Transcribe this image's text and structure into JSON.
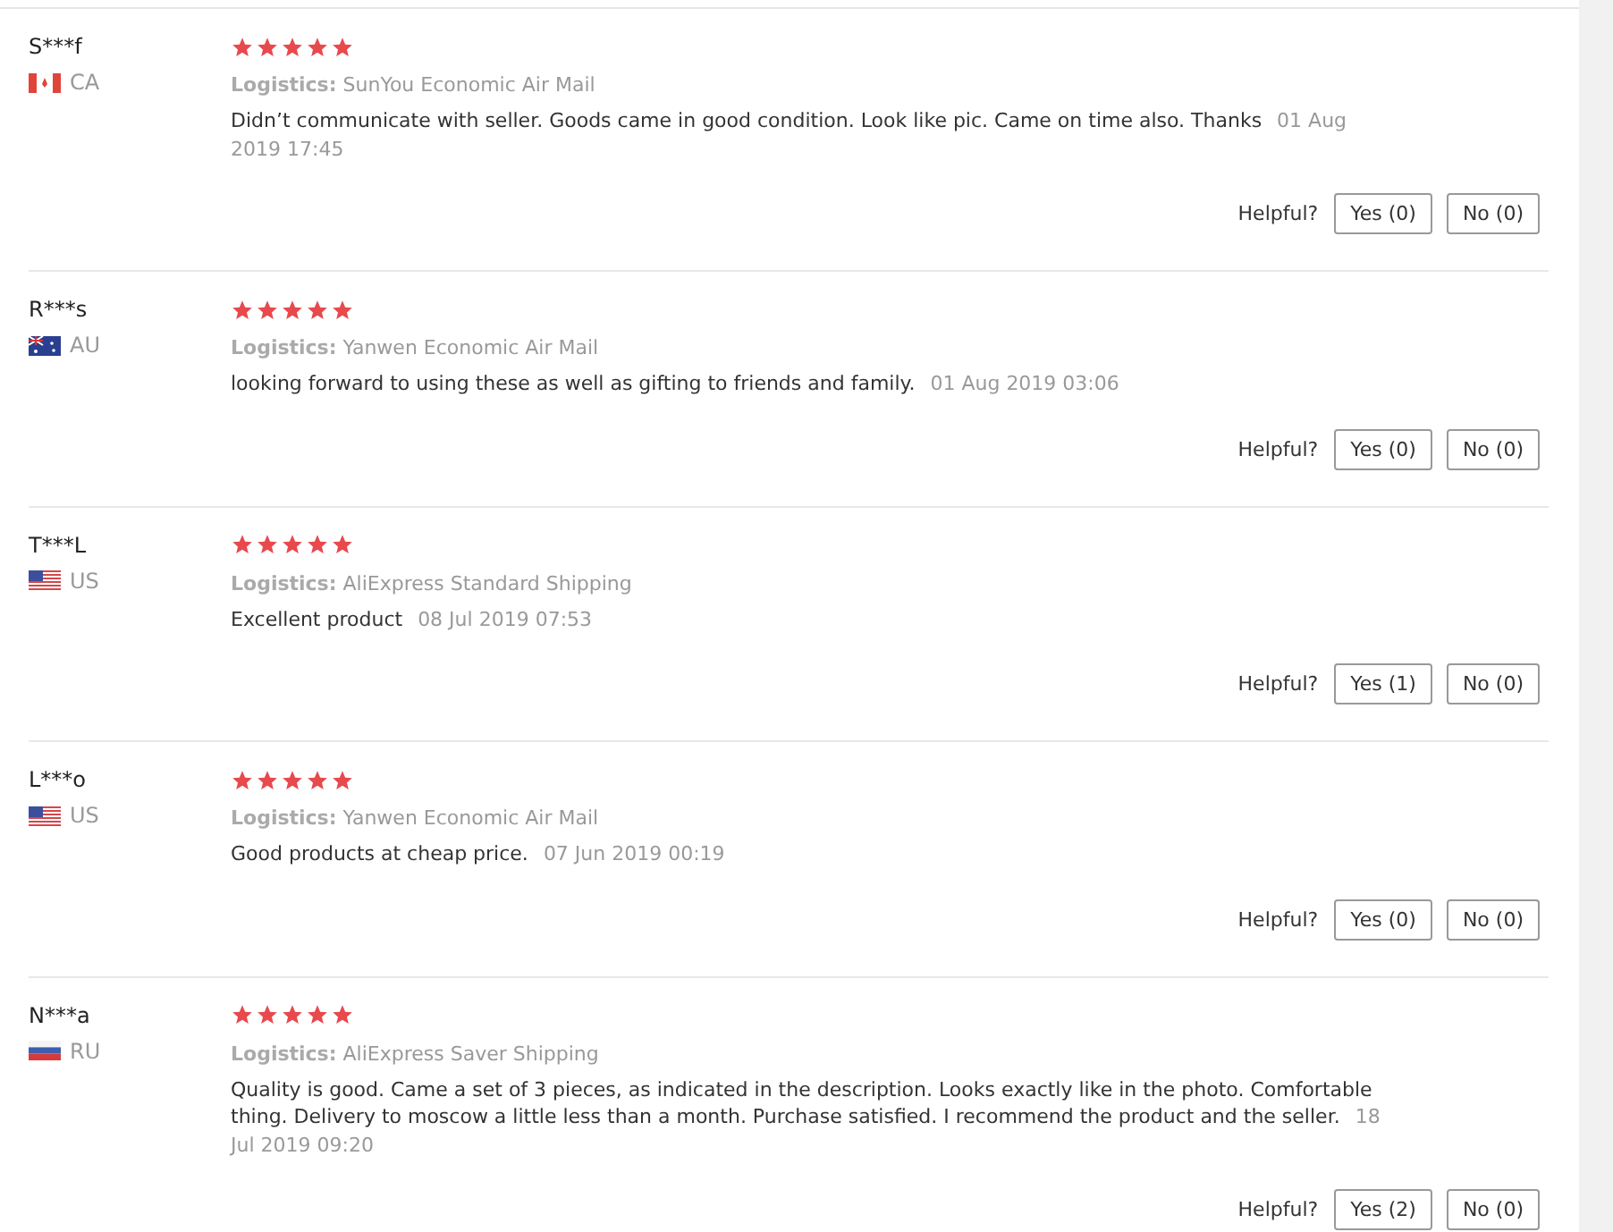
{
  "reviews": [
    {
      "name": "S***f",
      "kind": "ca",
      "country": "CA",
      "stars": 5,
      "logistics_label": "Logistics:",
      "logistics": "SunYou Economic Air Mail",
      "text": "Didn’t communicate with seller. Goods came in good condition. Look like pic. Came on time also. Thanks",
      "date": "01 Aug 2019 17:45",
      "helpful_label": "Helpful?",
      "yes": "Yes (0)",
      "no": "No (0)"
    },
    {
      "name": "R***s",
      "kind": "au",
      "country": "AU",
      "stars": 5,
      "logistics_label": "Logistics:",
      "logistics": "Yanwen Economic Air Mail",
      "text": "looking forward to using these as well as gifting to friends and family.",
      "date": "01 Aug 2019 03:06",
      "helpful_label": "Helpful?",
      "yes": "Yes (0)",
      "no": "No (0)"
    },
    {
      "name": "T***L",
      "kind": "us",
      "country": "US",
      "stars": 5,
      "logistics_label": "Logistics:",
      "logistics": "AliExpress Standard Shipping",
      "text": "Excellent product",
      "date": "08 Jul 2019 07:53",
      "helpful_label": "Helpful?",
      "yes": "Yes (1)",
      "no": "No (0)"
    },
    {
      "name": "L***o",
      "kind": "us",
      "country": "US",
      "stars": 5,
      "logistics_label": "Logistics:",
      "logistics": "Yanwen Economic Air Mail",
      "text": "Good products at cheap price.",
      "date": "07 Jun 2019 00:19",
      "helpful_label": "Helpful?",
      "yes": "Yes (0)",
      "no": "No (0)"
    },
    {
      "name": "N***a",
      "kind": "ru",
      "country": "RU",
      "stars": 5,
      "logistics_label": "Logistics:",
      "logistics": "AliExpress Saver Shipping",
      "text": "Quality is good. Came a set of 3 pieces, as indicated in the description. Looks exactly like in the photo. Comfortable thing. Delivery to moscow a little less than a month. Purchase satisfied. I recommend the product and the seller.",
      "date": "18 Jul 2019 09:20",
      "helpful_label": "Helpful?",
      "yes": "Yes (2)",
      "no": "No (0)"
    }
  ]
}
